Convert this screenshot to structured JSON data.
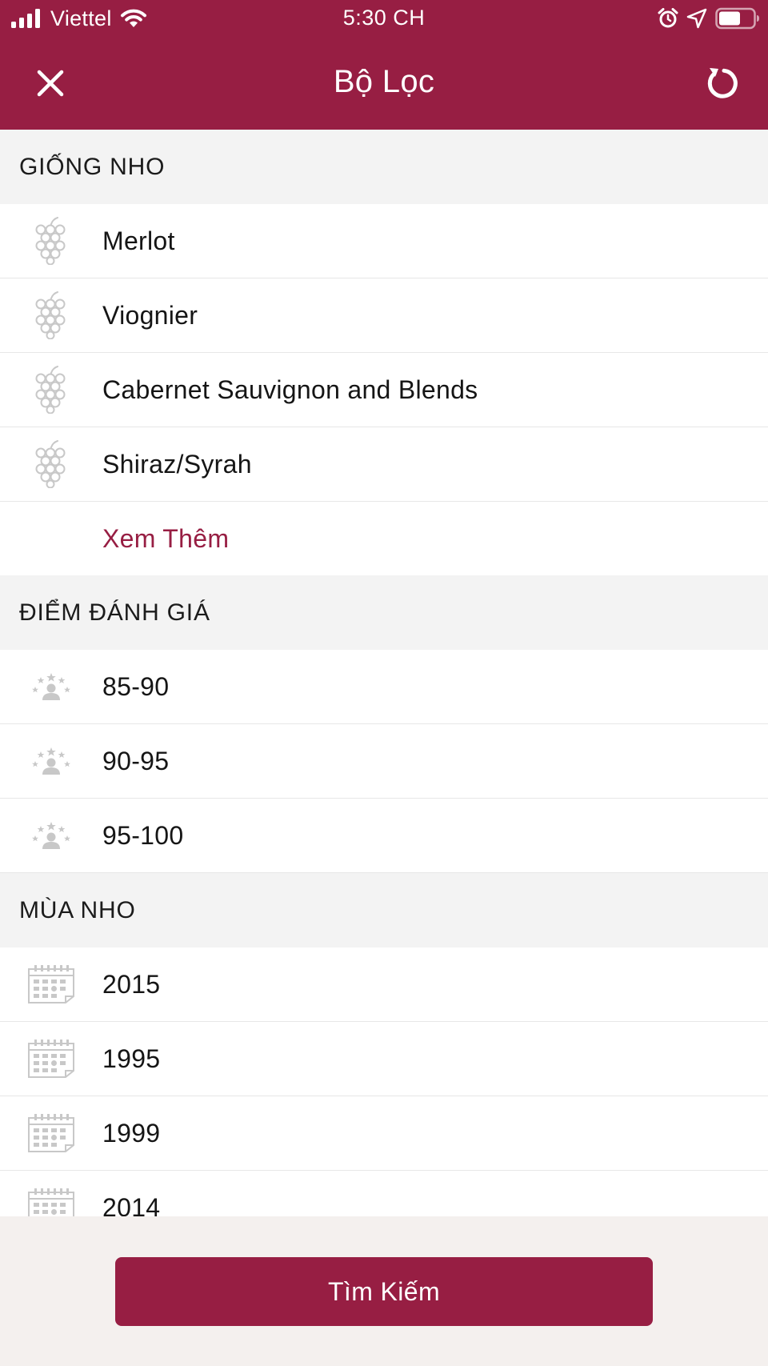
{
  "status_bar": {
    "carrier": "Viettel",
    "time": "5:30 CH"
  },
  "nav": {
    "title": "Bộ Lọc"
  },
  "colors": {
    "brand": "#971e43",
    "section_bg": "#f3f3f3",
    "footer_bg": "#f4f0ee",
    "icon_gray": "#c8c8c8"
  },
  "sections": {
    "grape": {
      "title": "GIỐNG NHO",
      "icon": "grape-icon",
      "items": [
        "Merlot",
        "Viognier",
        "Cabernet Sauvignon and Blends",
        "Shiraz/Syrah"
      ],
      "more": "Xem Thêm"
    },
    "rating": {
      "title": "ĐIỂM ĐÁNH GIÁ",
      "icon": "rating-stars-icon",
      "items": [
        "85-90",
        "90-95",
        "95-100"
      ]
    },
    "vintage": {
      "title": "MÙA NHO",
      "icon": "calendar-icon",
      "items": [
        "2015",
        "1995",
        "1999",
        "2014"
      ]
    }
  },
  "footer": {
    "search_label": "Tìm Kiếm"
  }
}
